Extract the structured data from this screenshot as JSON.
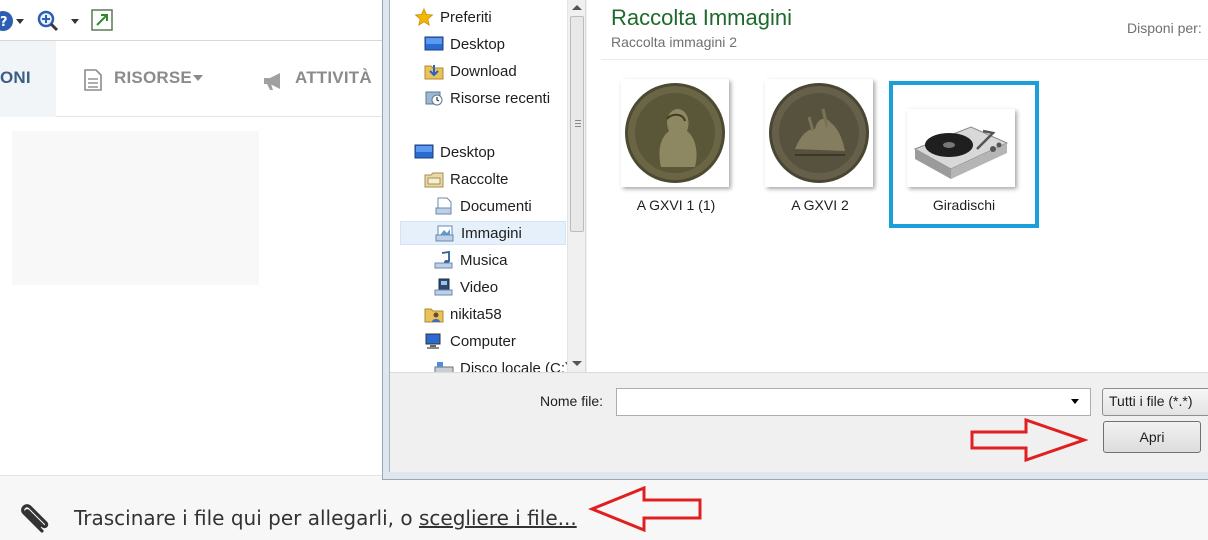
{
  "page": {
    "nav": {
      "items": [
        {
          "label": "ONI"
        },
        {
          "label": "RISORSE"
        },
        {
          "label": "ATTIVITÀ"
        }
      ]
    },
    "attach": {
      "text": "Trascinare i file qui per allegarli, o ",
      "link": "scegliere i file..."
    }
  },
  "dialog": {
    "nav_pane": {
      "items": [
        {
          "label": "Preferiti",
          "icon": "star-icon"
        },
        {
          "label": "Desktop",
          "icon": "desktop-icon"
        },
        {
          "label": "Download",
          "icon": "download-folder-icon"
        },
        {
          "label": "Risorse recenti",
          "icon": "recent-places-icon"
        },
        {
          "label": "Desktop",
          "icon": "desktop-icon"
        },
        {
          "label": "Raccolte",
          "icon": "libraries-icon"
        },
        {
          "label": "Documenti",
          "icon": "documents-icon"
        },
        {
          "label": "Immagini",
          "icon": "pictures-icon"
        },
        {
          "label": "Musica",
          "icon": "music-icon"
        },
        {
          "label": "Video",
          "icon": "video-icon"
        },
        {
          "label": "nikita58",
          "icon": "user-folder-icon"
        },
        {
          "label": "Computer",
          "icon": "computer-icon"
        },
        {
          "label": "Disco locale (C:)",
          "icon": "drive-icon"
        }
      ],
      "selected": "Immagini"
    },
    "library": {
      "title": "Raccolta Immagini",
      "subtitle": "Raccolta immagini 2",
      "arrange_label": "Disponi per:"
    },
    "files": [
      {
        "name": "A GXVI 1 (1)",
        "icon": "coin-portrait-thumbnail"
      },
      {
        "name": "A GXVI 2",
        "icon": "coin-reverse-thumbnail"
      },
      {
        "name": "Giradischi",
        "icon": "turntable-thumbnail"
      }
    ],
    "selected_file": "Giradischi",
    "filename_label": "Nome file:",
    "filename_value": "",
    "filter": "Tutti i file (*.*)",
    "open_label": "Apri"
  },
  "colors": {
    "library_title": "#1e6a2b",
    "selection_border": "#1a9fd8",
    "annotation_red": "#e02020"
  }
}
